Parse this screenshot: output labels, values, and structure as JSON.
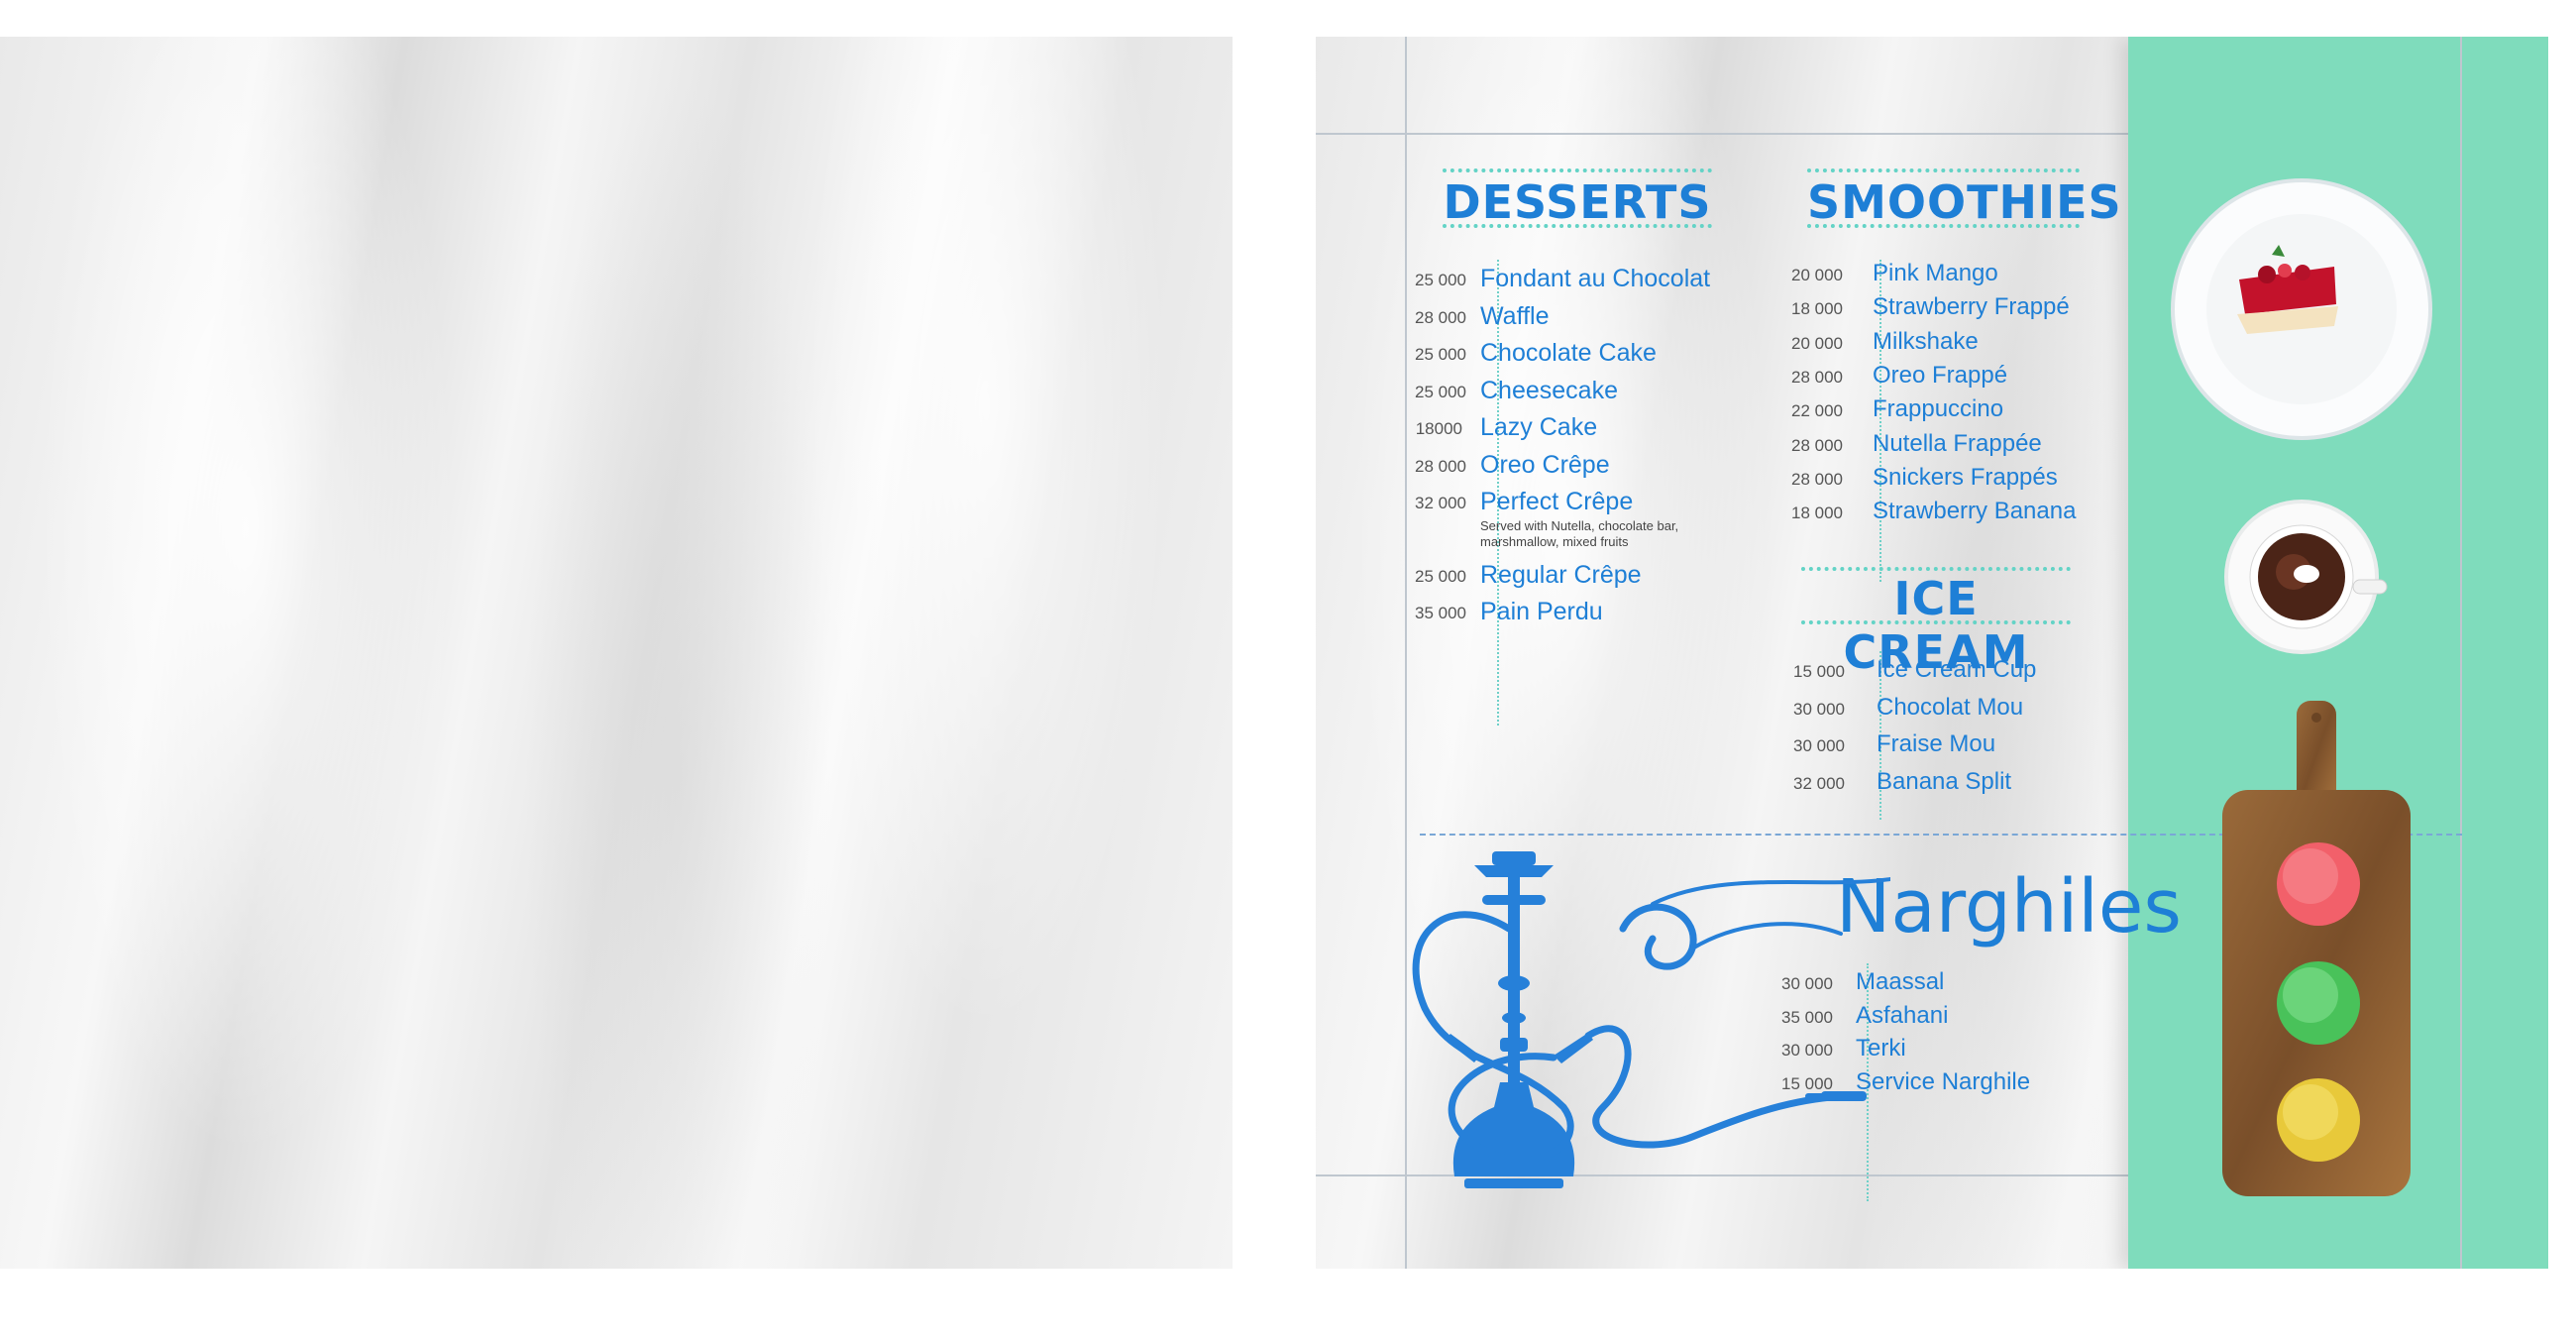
{
  "desserts": {
    "title": "DESSERTS",
    "items": [
      {
        "price": "25 000",
        "name": "Fondant au Chocolat"
      },
      {
        "price": "28 000",
        "name": "Waffle"
      },
      {
        "price": "25 000",
        "name": "Chocolate Cake"
      },
      {
        "price": "25 000",
        "name": "Cheesecake"
      },
      {
        "price": "18000",
        "name": "Lazy Cake"
      },
      {
        "price": "28 000",
        "name": "Oreo Crêpe"
      },
      {
        "price": "32 000",
        "name": "Perfect Crêpe",
        "note": "Served with Nutella, chocolate bar, marshmallow, mixed fruits"
      },
      {
        "price": "25 000",
        "name": "Regular Crêpe"
      },
      {
        "price": "35 000",
        "name": "Pain Perdu"
      }
    ]
  },
  "smoothies": {
    "title": "SMOOTHIES",
    "items": [
      {
        "price": "20 000",
        "name": "Pink Mango"
      },
      {
        "price": "18 000",
        "name": "Strawberry Frappé"
      },
      {
        "price": "20 000",
        "name": "Milkshake"
      },
      {
        "price": "28 000",
        "name": "Oreo Frappé"
      },
      {
        "price": "22 000",
        "name": "Frappuccino"
      },
      {
        "price": "28 000",
        "name": "Nutella Frappée"
      },
      {
        "price": "28 000",
        "name": "Snickers Frappés"
      },
      {
        "price": "18 000",
        "name": "Strawberry Banana"
      }
    ]
  },
  "ice_cream": {
    "title": "ICE CREAM",
    "items": [
      {
        "price": "15 000",
        "name": "Ice Cream Cup"
      },
      {
        "price": "30 000",
        "name": "Chocolat Mou"
      },
      {
        "price": "30 000",
        "name": "Fraise Mou"
      },
      {
        "price": "32 000",
        "name": "Banana Split"
      }
    ]
  },
  "narghiles": {
    "title": "Narghiles",
    "items": [
      {
        "price": "30 000",
        "name": "Maassal"
      },
      {
        "price": "35 000",
        "name": "Asfahani"
      },
      {
        "price": "30 000",
        "name": "Terki"
      },
      {
        "price": "15 000",
        "name": "Service Narghile"
      }
    ]
  },
  "colors": {
    "accent": "#1e7fd6",
    "mint": "#7fdcbc",
    "dots": "#63d3c6"
  },
  "icons": [
    "hookah-icon",
    "cheesecake-plate-image",
    "lava-cake-cup-image",
    "ice-cream-board-image"
  ]
}
